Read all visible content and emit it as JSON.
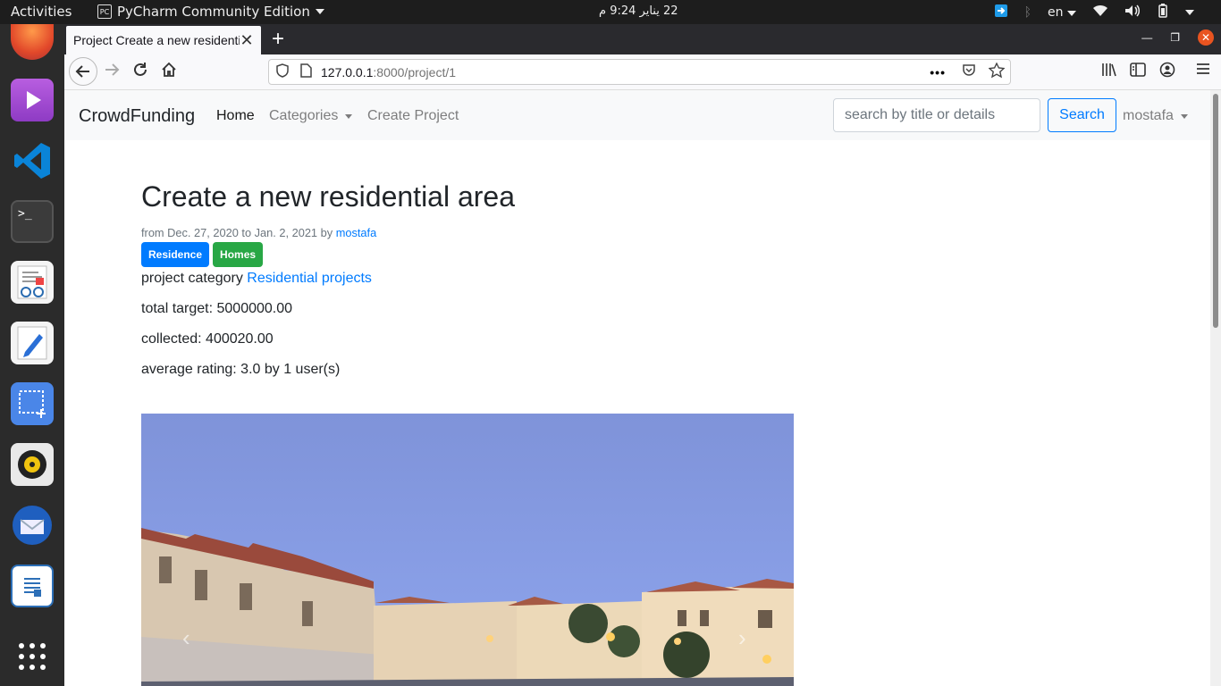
{
  "system_bar": {
    "activities": "Activities",
    "app_name": "PyCharm Community Edition",
    "clock": "22 يناير  9:24 م",
    "language": "en"
  },
  "browser": {
    "tab_title": "Project Create a new residential area",
    "url_host": "127.0.0.1",
    "url_path": ":8000/project/1"
  },
  "site": {
    "brand": "CrowdFunding",
    "nav": {
      "home": "Home",
      "categories": "Categories",
      "create_project": "Create Project"
    },
    "search": {
      "placeholder": "search by title or details",
      "button": "Search"
    },
    "user": "mostafa"
  },
  "project": {
    "title": "Create a new residential area",
    "meta_from": "from Dec. 27, 2020 to Jan. 2, 2021 by ",
    "meta_author": "mostafa",
    "tags": [
      "Residence",
      "Homes"
    ],
    "category_label": "project category ",
    "category_value": "Residential projects",
    "total_target": "total target: 5000000.00",
    "collected": "collected: 400020.00",
    "average_rating": "average rating: 3.0 by 1 user(s)"
  },
  "colors": {
    "primary": "#007bff",
    "success": "#28a745",
    "navbar_bg": "#f8f9fa",
    "topbar_bg": "#1d1d1d",
    "dock_bg": "#2b2b2b"
  }
}
